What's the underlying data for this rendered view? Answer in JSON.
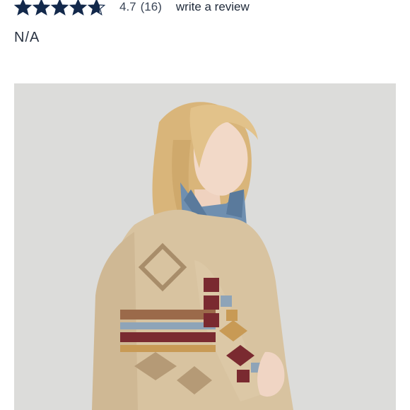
{
  "rating": {
    "stars_filled": 4.7,
    "stars_total": 5,
    "value": "4.7",
    "count": "(16)",
    "star_color": "#13294b"
  },
  "review_link": {
    "label": "write a review"
  },
  "price": {
    "label": "N/A"
  },
  "image": {
    "icon": "product-photo",
    "backdrop_color": "#dcdcda",
    "cardigan_color": "#d8c3a0",
    "accent_colors": [
      "#7a2a30",
      "#c89a55",
      "#8ea4b8",
      "#9b6a4a"
    ]
  }
}
